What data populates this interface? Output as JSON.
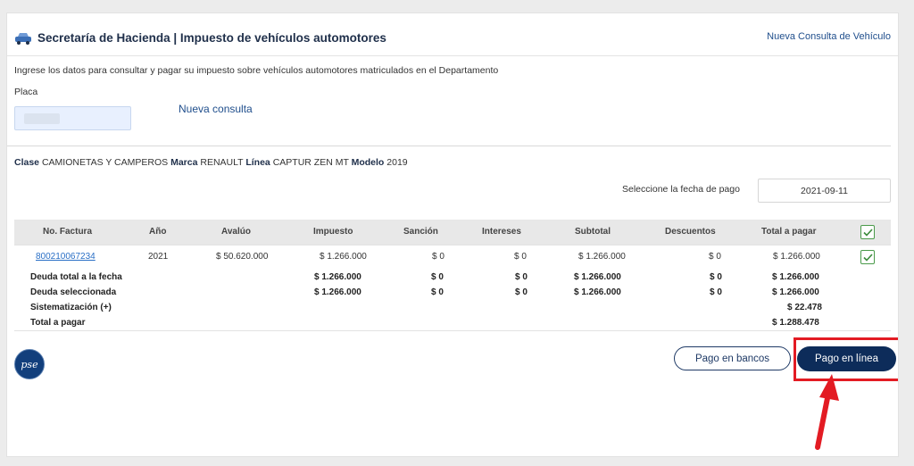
{
  "header": {
    "title": "Secretaría de Hacienda | Impuesto de vehículos automotores",
    "new_vehicle_link": "Nueva Consulta de Vehículo"
  },
  "form": {
    "intro": "Ingrese los datos para consultar y pagar su impuesto sobre vehículos automotores matriculados en el Departamento",
    "placa_label": "Placa",
    "placa_value": "",
    "new_query_link": "Nueva consulta"
  },
  "vehicle": {
    "clase_label": "Clase",
    "clase": "CAMIONETAS Y CAMPEROS",
    "marca_label": "Marca",
    "marca": "RENAULT",
    "linea_label": "Línea",
    "linea": "CAPTUR ZEN MT",
    "modelo_label": "Modelo",
    "modelo": "2019"
  },
  "payment_date": {
    "label": "Seleccione la fecha de pago",
    "value": "2021-09-11"
  },
  "table": {
    "headers": [
      "No. Factura",
      "Año",
      "Avalúo",
      "Impuesto",
      "Sanción",
      "Intereses",
      "Subtotal",
      "Descuentos",
      "Total a pagar"
    ],
    "rows": [
      {
        "factura": "800210067234",
        "anio": "2021",
        "avaluo": "$ 50.620.000",
        "impuesto": "$ 1.266.000",
        "sancion": "$ 0",
        "intereses": "$ 0",
        "subtotal": "$ 1.266.000",
        "descuentos": "$ 0",
        "total": "$ 1.266.000",
        "checked": true
      }
    ],
    "summary": [
      {
        "label": "Deuda total a la fecha",
        "impuesto": "$ 1.266.000",
        "sancion": "$ 0",
        "intereses": "$ 0",
        "subtotal": "$ 1.266.000",
        "descuentos": "$ 0",
        "total": "$ 1.266.000"
      },
      {
        "label": "Deuda seleccionada",
        "impuesto": "$ 1.266.000",
        "sancion": "$ 0",
        "intereses": "$ 0",
        "subtotal": "$ 1.266.000",
        "descuentos": "$ 0",
        "total": "$ 1.266.000"
      },
      {
        "label": "Sistematización (+)",
        "total": "$ 22.478"
      },
      {
        "label": "Total a pagar",
        "total": "$ 1.288.478"
      }
    ]
  },
  "pse_logo": "pse",
  "buttons": {
    "bancos": "Pago en bancos",
    "linea": "Pago en línea"
  },
  "colors": {
    "accent_navy": "#0d2c5a",
    "link_blue": "#2a6fc6",
    "highlight_red": "#e31b23",
    "check_green": "#4a9a4a"
  }
}
